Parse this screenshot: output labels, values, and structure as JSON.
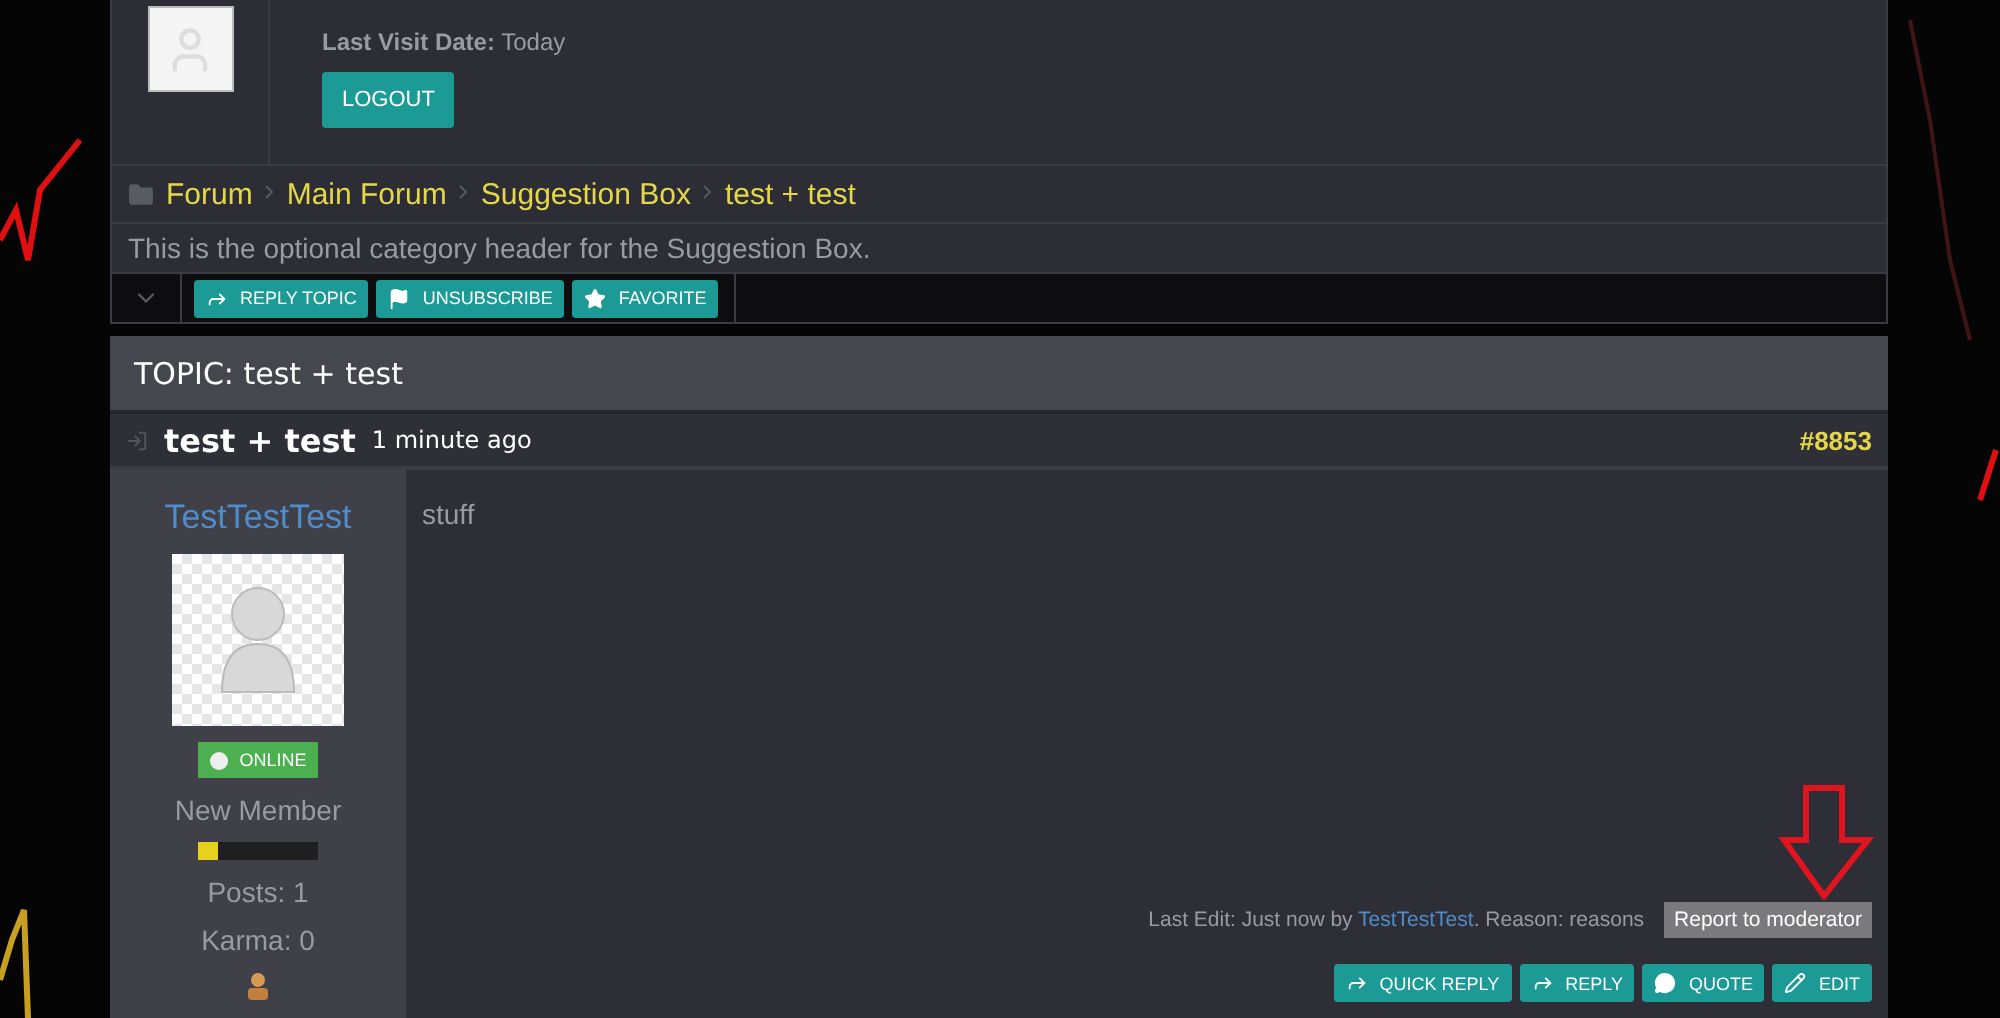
{
  "profile": {
    "last_visit_label": "Last Visit Date:",
    "last_visit_value": "Today",
    "logout": "LOGOUT"
  },
  "breadcrumbs": [
    "Forum",
    "Main Forum",
    "Suggestion Box",
    "test + test"
  ],
  "category_header": "This is the optional category header for the Suggestion Box.",
  "toolbar": [
    {
      "label": "REPLY TOPIC",
      "kind": "reply"
    },
    {
      "label": "UNSUBSCRIBE",
      "kind": "flag"
    },
    {
      "label": "FAVORITE",
      "kind": "star"
    }
  ],
  "topic_title": "TOPIC: test + test",
  "post": {
    "title": "test + test",
    "time": "1 minute ago",
    "number": "#8853",
    "author": "TestTestTest",
    "status": "ONLINE",
    "rank": "New Member",
    "rank_bar": {
      "level": 0.17
    },
    "posts": "Posts: 1",
    "karma": "Karma: 0",
    "body": "stuff",
    "last_edit": {
      "prefix": "Last Edit: Just now by",
      "user": "TestTestTest",
      "suffix": ". Reason: reasons"
    },
    "report": "Report to moderator",
    "actions": [
      {
        "label": "QUICK REPLY",
        "kind": "reply"
      },
      {
        "label": "REPLY",
        "kind": "reply"
      },
      {
        "label": "QUOTE",
        "kind": "quote"
      },
      {
        "label": "EDIT",
        "kind": "edit"
      }
    ]
  }
}
